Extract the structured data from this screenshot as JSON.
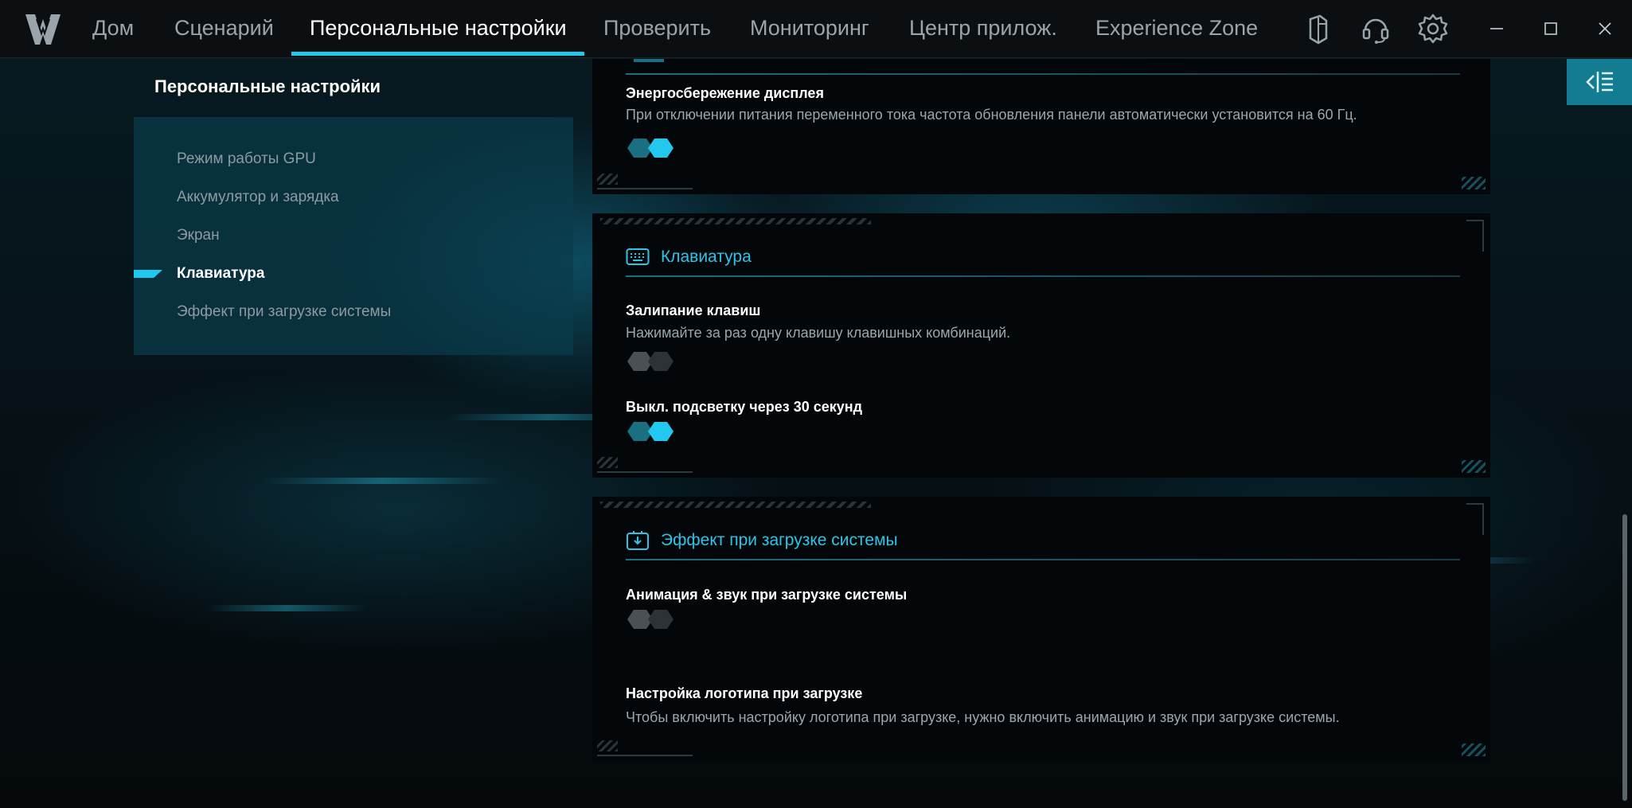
{
  "nav": {
    "items": [
      "Дом",
      "Сценарий",
      "Персональные настройки",
      "Проверить",
      "Мониторинг",
      "Центр прилож.",
      "Experience Zone"
    ],
    "active_index": 2
  },
  "top_icons": [
    "keyboard-mouse-icon",
    "headset-icon",
    "gear-icon"
  ],
  "window_controls": [
    "minimize-icon",
    "maximize-icon",
    "close-icon"
  ],
  "sidebar": {
    "title": "Персональные настройки",
    "items": [
      {
        "label": "Режим работы GPU"
      },
      {
        "label": "Аккумулятор и зарядка"
      },
      {
        "label": "Экран"
      },
      {
        "label": "Клавиатура",
        "active": true
      },
      {
        "label": "Эффект при загрузке системы"
      }
    ]
  },
  "display_card": {
    "option": {
      "title": "Энергосбережение дисплея",
      "desc": "При отключении питания переменного тока частота обновления панели автоматически установится на 60 Гц.",
      "enabled": true
    }
  },
  "keyboard_card": {
    "title": "Клавиатура",
    "icon": "keyboard-icon",
    "options": [
      {
        "title": "Залипание клавиш",
        "desc": "Нажимайте за раз одну клавишу клавишных комбинаций.",
        "enabled": false
      },
      {
        "title": "Выкл. подсветку через 30 секунд",
        "enabled": true
      }
    ]
  },
  "boot_card": {
    "title": "Эффект при загрузке системы",
    "icon": "boot-effect-icon",
    "options": [
      {
        "title": "Анимация & звук при загрузке системы",
        "enabled": false
      },
      {
        "title": "Настройка логотипа при загрузке",
        "desc": "Чтобы включить настройку логотипа при загрузке, нужно включить анимацию и звук при загрузке системы."
      }
    ]
  },
  "colors": {
    "accent": "#1ec9f0",
    "panel": "#0a3c4b",
    "card": "#03070a"
  }
}
